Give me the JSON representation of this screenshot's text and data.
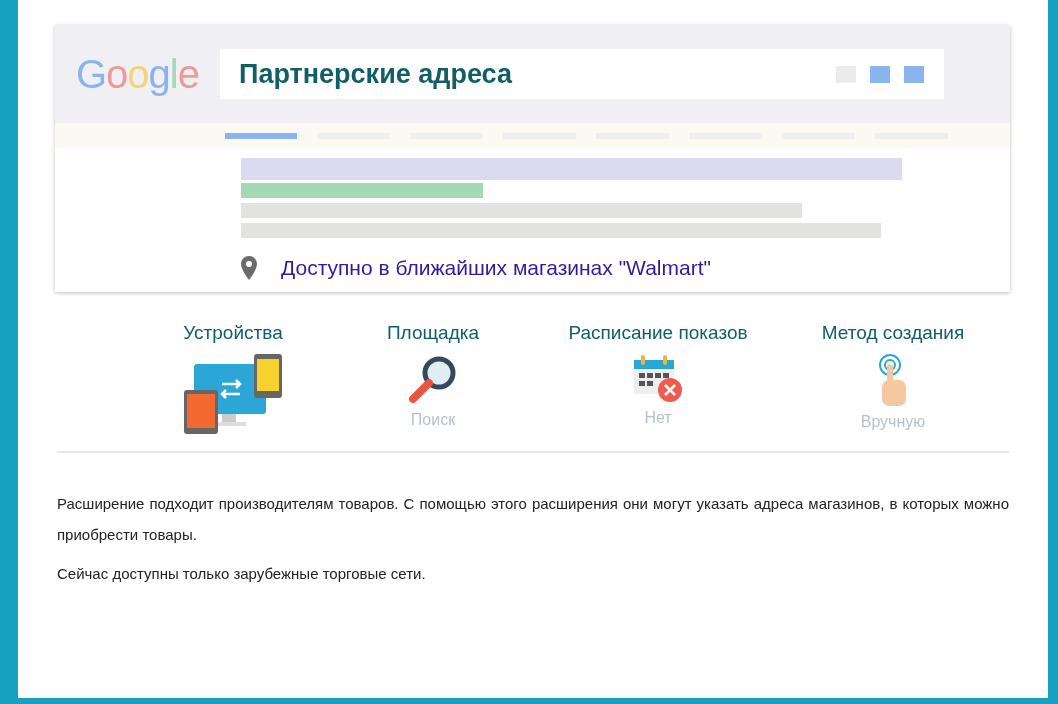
{
  "preview": {
    "logo": "Google",
    "title": "Партнерские адреса",
    "location": "Доступно в ближайших магазинах \"Walmart\""
  },
  "features": [
    {
      "kind": "devices",
      "title": "Устройства"
    },
    {
      "kind": "search",
      "title": "Площадка",
      "value": "Поиск"
    },
    {
      "kind": "calendar",
      "title": "Расписание показов",
      "value": "Нет"
    },
    {
      "kind": "touch",
      "title": "Метод создания",
      "value": "Вручную"
    }
  ],
  "description": [
    "Расширение подходит производителям товаров. С помощью этого расширения они могут указать адреса магазинов, в которых можно приобрести товары.",
    "Сейчас доступны только зарубежные торговые сети."
  ]
}
